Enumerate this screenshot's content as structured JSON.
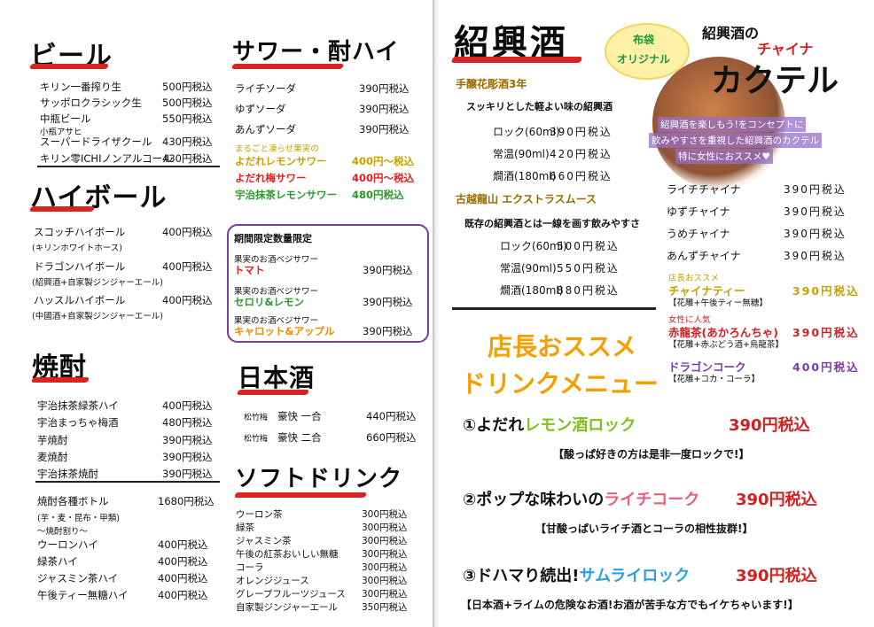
{
  "beer": {
    "title": "ビール",
    "items": [
      {
        "name": "キリン一番搾り生",
        "price": "500円税込"
      },
      {
        "name": "サッポロクラシック生",
        "price": "500円税込"
      },
      {
        "name": "中瓶ビール",
        "price": "550円税込"
      },
      {
        "note": "小瓶アサヒ",
        "name": "スーパードライザクール",
        "price": "430円税込"
      },
      {
        "name": "キリン零ICHIノンアルコール",
        "price": "430円税込"
      }
    ]
  },
  "highball": {
    "title": "ハイボール",
    "items": [
      {
        "name": "スコッチハイボール",
        "note": "(キリンホワイトホース)",
        "price": "400円税込"
      },
      {
        "name": "ドラゴンハイボール",
        "note": "(紹興酒+自家製ジンジャーエール)",
        "price": "400円税込"
      },
      {
        "name": "ハッスルハイボール",
        "note": "(中國酒+自家製ジンジャーエール)",
        "price": "400円税込"
      }
    ]
  },
  "shochu": {
    "title": "焼酎",
    "items": [
      {
        "name": "宇治抹茶緑茶ハイ",
        "price": "400円税込"
      },
      {
        "name": "宇治まっちゃ梅酒",
        "price": "480円税込"
      },
      {
        "name": "芋焼酎",
        "price": "390円税込"
      },
      {
        "name": "麦焼酎",
        "price": "390円税込"
      },
      {
        "name": "宇治抹茶焼酎",
        "price": "390円税込"
      }
    ],
    "bottle": {
      "name": "焼酎各種ボトル",
      "price": "1680円税込",
      "note1": "(芋・麦・昆布・甲類)",
      "note2": "〜焼酎割り〜"
    },
    "mixers": [
      {
        "name": "ウーロンハイ",
        "price": "400円税込"
      },
      {
        "name": "緑茶ハイ",
        "price": "400円税込"
      },
      {
        "name": "ジャスミン茶ハイ",
        "price": "400円税込"
      },
      {
        "name": "午後ティー無糖ハイ",
        "price": "400円税込"
      }
    ]
  },
  "sour": {
    "title": "サワー・酎ハイ",
    "items": [
      {
        "name": "ライチソーダ",
        "price": "390円税込"
      },
      {
        "name": "ゆずソーダ",
        "price": "390円税込"
      },
      {
        "name": "あんずソーダ",
        "price": "390円税込"
      }
    ],
    "special": [
      {
        "note": "まるごと凍らせ果実の",
        "name": "よだれレモンサワー",
        "price": "400円〜税込",
        "color": "#c9a000"
      },
      {
        "name": "よだれ梅サワー",
        "price": "400円〜税込",
        "color": "#e02020"
      },
      {
        "name": "宇治抹茶レモンサワー",
        "price": "480円税込",
        "color": "#2a9a2a"
      }
    ]
  },
  "limited": {
    "title": "期間限定数量限定",
    "items": [
      {
        "note": "果実のお酒ベジサワー",
        "name": "トマト",
        "price": "390円税込",
        "color": "#e02020"
      },
      {
        "note": "果実のお酒ベジサワー",
        "name": "セロリ&レモン",
        "price": "390円税込",
        "color": "#2a9a2a"
      },
      {
        "note": "果実のお酒ベジサワー",
        "name": "キャロット&アップル",
        "price": "390円税込",
        "color": "#f08a00"
      }
    ]
  },
  "sake": {
    "title": "日本酒",
    "items": [
      {
        "note": "松竹梅",
        "name": "豪快 一合",
        "price": "440円税込"
      },
      {
        "note": "松竹梅",
        "name": "豪快 二合",
        "price": "660円税込"
      }
    ]
  },
  "soft": {
    "title": "ソフトドリンク",
    "items": [
      {
        "name": "ウーロン茶",
        "price": "300円税込"
      },
      {
        "name": "緑茶",
        "price": "300円税込"
      },
      {
        "name": "ジャスミン茶",
        "price": "300円税込"
      },
      {
        "name": "午後の紅茶おいしい無糖",
        "price": "300円税込"
      },
      {
        "name": "コーラ",
        "price": "300円税込"
      },
      {
        "name": "オレンジジュース",
        "price": "300円税込"
      },
      {
        "name": "グレープフルーツジュース",
        "price": "300円税込"
      },
      {
        "name": "自家製ジンジャーエール",
        "price": "350円税込"
      }
    ]
  },
  "shaoxing": {
    "title": "紹興酒",
    "g1": {
      "title": "手醸花彫酒3年",
      "desc": "スッキリとした軽よい味の紹興酒",
      "items": [
        {
          "name": "ロック(60ml)",
          "price": "390円税込"
        },
        {
          "name": "常温(90ml)",
          "price": "420円税込"
        },
        {
          "name": "燗酒(180ml)",
          "price": "660円税込"
        }
      ]
    },
    "g2": {
      "title": "古越龍山 エクストラスムース",
      "desc": "既存の紹興酒とは一線を画す飲みやすさ",
      "items": [
        {
          "name": "ロック(60ml)",
          "price": "500円税込"
        },
        {
          "name": "常温(90ml)",
          "price": "550円税込"
        },
        {
          "name": "燗酒(180ml)",
          "price": "880円税込"
        }
      ]
    }
  },
  "cocktail": {
    "badge1": "布袋",
    "badge2": "オリジナル",
    "title1": "紹興酒の",
    "title2": "チャイナ",
    "title3": "カクテル",
    "desc1": "紹興酒を楽しもう!をコンセプトに",
    "desc2": "飲みやすさを重視した紹興酒のカクテル",
    "desc3": "特に女性におススメ♥",
    "items": [
      {
        "name": "ライチチャイナ",
        "price": "390円税込"
      },
      {
        "name": "ゆずチャイナ",
        "price": "390円税込"
      },
      {
        "name": "うめチャイナ",
        "price": "390円税込"
      },
      {
        "name": "あんずチャイナ",
        "price": "390円税込"
      }
    ],
    "special": [
      {
        "note": "店長おススメ",
        "name": "チャイナティー",
        "sub": "【花雕+午後ティー無糖】",
        "price": "390円税込",
        "color": "#c9a000"
      },
      {
        "note": "女性に人気",
        "name": "赤龍茶(あかろんちゃ)",
        "sub": "【花雕+赤ぶどう酒+烏龍茶】",
        "price": "390円税込",
        "color": "#d42020"
      },
      {
        "name": "ドラゴンコーク",
        "sub": "【花雕+コカ・コーラ】",
        "price": "400円税込",
        "color": "#7a3aa8"
      }
    ]
  },
  "recommend": {
    "title1": "店長おススメ",
    "title2": "ドリンクメニュー",
    "items": [
      {
        "num": "①",
        "pre": "よだれ",
        "name": "レモン酒ロック",
        "price": "390円税込",
        "color": "#7fc21d",
        "note": "【酸っぱ好きの方は是非一度ロックで!】"
      },
      {
        "num": "②",
        "pre": "ポップな味わいの",
        "name": "ライチコーク",
        "price": "390円税込",
        "color": "#e8607a",
        "note": "【甘酸っぱいライチ酒とコーラの相性抜群!】"
      },
      {
        "num": "③",
        "pre": "ドハマり続出!",
        "name": "サムライロック",
        "price": "390円税込",
        "color": "#2aa0e0",
        "note": "【日本酒+ライムの危険なお酒!お酒が苦手な方でもイケちゃいます!】"
      }
    ]
  },
  "colors": {
    "accent": "#d22020",
    "title": "#0b0b0b",
    "purple": "#7a3aa8",
    "recommend": "#f2a000"
  }
}
